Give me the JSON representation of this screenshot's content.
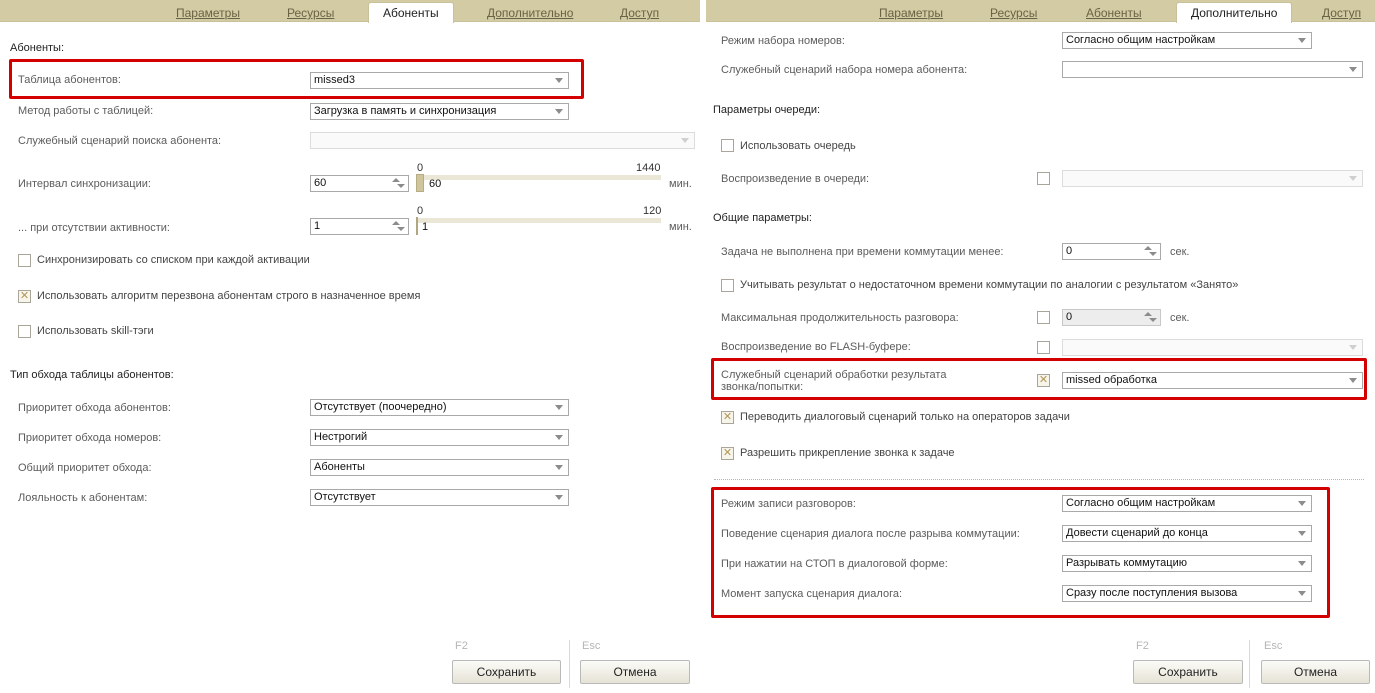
{
  "left": {
    "tabs": [
      "Параметры",
      "Ресурсы",
      "Абоненты",
      "Дополнительно",
      "Доступ"
    ],
    "active_tab": "Абоненты",
    "section_subscribers": "Абоненты:",
    "fields": {
      "table": {
        "label": "Таблица абонентов:",
        "value": "missed3"
      },
      "method": {
        "label": "Метод работы с таблицей:",
        "value": "Загрузка в память и синхронизация"
      },
      "search_script": {
        "label": "Служебный сценарий поиска абонента:",
        "value": ""
      },
      "sync_interval": {
        "label": "Интервал синхронизации:",
        "value": "60",
        "slider_min": "0",
        "slider_max": "1440",
        "slider_value": "60",
        "unit": "мин."
      },
      "inactivity": {
        "label": "... при отсутствии активности:",
        "value": "1",
        "slider_min": "0",
        "slider_max": "120",
        "slider_value": "1",
        "unit": "мин."
      }
    },
    "checkboxes": [
      {
        "label": "Синхронизировать со списком при каждой активации",
        "checked": false
      },
      {
        "label": "Использовать алгоритм перезвона абонентам строго в назначенное время",
        "checked": true
      },
      {
        "label": "Использовать skill-тэги",
        "checked": false
      }
    ],
    "section_traversal": "Тип обхода таблицы абонентов:",
    "traversal": [
      {
        "label": "Приоритет обхода абонентов:",
        "value": "Отсутствует (поочередно)"
      },
      {
        "label": "Приоритет обхода номеров:",
        "value": "Нестрогий"
      },
      {
        "label": "Общий приоритет обхода:",
        "value": "Абоненты"
      },
      {
        "label": "Лояльность к абонентам:",
        "value": "Отсутствует"
      }
    ],
    "footer": {
      "save_key": "F2",
      "save_label": "Сохранить",
      "cancel_key": "Esc",
      "cancel_label": "Отмена"
    }
  },
  "right": {
    "tabs": [
      "Параметры",
      "Ресурсы",
      "Абоненты",
      "Дополнительно",
      "Доступ"
    ],
    "active_tab": "Дополнительно",
    "dial_mode": {
      "label": "Режим набора номеров:",
      "value": "Согласно общим настройкам"
    },
    "dial_script": {
      "label": "Служебный сценарий набора номера абонента:",
      "value": ""
    },
    "section_queue": "Параметры очереди:",
    "use_queue": {
      "label": "Использовать очередь",
      "checked": false
    },
    "queue_playback": {
      "label": "Воспроизведение в очереди:",
      "value": "",
      "checked": false
    },
    "section_common": "Общие параметры:",
    "task_failed": {
      "label": "Задача не выполнена при времени коммутации менее:",
      "value": "0",
      "unit": "сек."
    },
    "count_result": {
      "label": "Учитывать результат о недостаточном времени коммутации по аналогии с результатом «Занято»",
      "checked": false
    },
    "max_duration": {
      "label": "Максимальная продолжительность разговора:",
      "value": "0",
      "unit": "сек.",
      "checked": false
    },
    "flash_playback": {
      "label": "Воспроизведение во FLASH-буфере:",
      "value": "",
      "checked": false
    },
    "result_script": {
      "label_line1": "Служебный сценарий обработки результата",
      "label_line2": "звонка/попытки:",
      "value": "missed обработка",
      "checked": true
    },
    "only_task_operators": {
      "label": "Переводить диалоговый сценарий только на операторов задачи",
      "checked": true
    },
    "allow_attach": {
      "label": "Разрешить прикрепление звонка к задаче",
      "checked": true
    },
    "recording": [
      {
        "label": "Режим записи разговоров:",
        "value": "Согласно общим настройкам"
      },
      {
        "label": "Поведение сценария диалога после разрыва коммутации:",
        "value": "Довести сценарий до конца"
      },
      {
        "label": "При нажатии на СТОП в диалоговой форме:",
        "value": "Разрывать коммутацию"
      },
      {
        "label": "Момент запуска сценария диалога:",
        "value": "Сразу после поступления вызова"
      }
    ],
    "footer": {
      "save_key": "F2",
      "save_label": "Сохранить",
      "cancel_key": "Esc",
      "cancel_label": "Отмена"
    }
  },
  "colors": {
    "highlight": "#d40000",
    "tabbar": "#d2cba4",
    "checkmark": "#b09658"
  }
}
